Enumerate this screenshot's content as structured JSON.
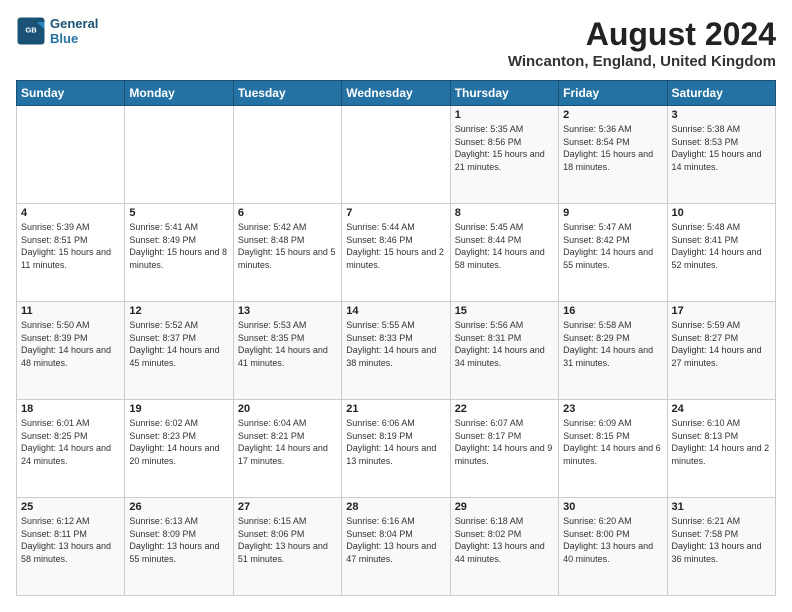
{
  "logo": {
    "line1": "General",
    "line2": "Blue"
  },
  "header": {
    "title": "August 2024",
    "subtitle": "Wincanton, England, United Kingdom"
  },
  "weekdays": [
    "Sunday",
    "Monday",
    "Tuesday",
    "Wednesday",
    "Thursday",
    "Friday",
    "Saturday"
  ],
  "weeks": [
    [
      {
        "day": "",
        "text": ""
      },
      {
        "day": "",
        "text": ""
      },
      {
        "day": "",
        "text": ""
      },
      {
        "day": "",
        "text": ""
      },
      {
        "day": "1",
        "text": "Sunrise: 5:35 AM\nSunset: 8:56 PM\nDaylight: 15 hours and 21 minutes."
      },
      {
        "day": "2",
        "text": "Sunrise: 5:36 AM\nSunset: 8:54 PM\nDaylight: 15 hours and 18 minutes."
      },
      {
        "day": "3",
        "text": "Sunrise: 5:38 AM\nSunset: 8:53 PM\nDaylight: 15 hours and 14 minutes."
      }
    ],
    [
      {
        "day": "4",
        "text": "Sunrise: 5:39 AM\nSunset: 8:51 PM\nDaylight: 15 hours and 11 minutes."
      },
      {
        "day": "5",
        "text": "Sunrise: 5:41 AM\nSunset: 8:49 PM\nDaylight: 15 hours and 8 minutes."
      },
      {
        "day": "6",
        "text": "Sunrise: 5:42 AM\nSunset: 8:48 PM\nDaylight: 15 hours and 5 minutes."
      },
      {
        "day": "7",
        "text": "Sunrise: 5:44 AM\nSunset: 8:46 PM\nDaylight: 15 hours and 2 minutes."
      },
      {
        "day": "8",
        "text": "Sunrise: 5:45 AM\nSunset: 8:44 PM\nDaylight: 14 hours and 58 minutes."
      },
      {
        "day": "9",
        "text": "Sunrise: 5:47 AM\nSunset: 8:42 PM\nDaylight: 14 hours and 55 minutes."
      },
      {
        "day": "10",
        "text": "Sunrise: 5:48 AM\nSunset: 8:41 PM\nDaylight: 14 hours and 52 minutes."
      }
    ],
    [
      {
        "day": "11",
        "text": "Sunrise: 5:50 AM\nSunset: 8:39 PM\nDaylight: 14 hours and 48 minutes."
      },
      {
        "day": "12",
        "text": "Sunrise: 5:52 AM\nSunset: 8:37 PM\nDaylight: 14 hours and 45 minutes."
      },
      {
        "day": "13",
        "text": "Sunrise: 5:53 AM\nSunset: 8:35 PM\nDaylight: 14 hours and 41 minutes."
      },
      {
        "day": "14",
        "text": "Sunrise: 5:55 AM\nSunset: 8:33 PM\nDaylight: 14 hours and 38 minutes."
      },
      {
        "day": "15",
        "text": "Sunrise: 5:56 AM\nSunset: 8:31 PM\nDaylight: 14 hours and 34 minutes."
      },
      {
        "day": "16",
        "text": "Sunrise: 5:58 AM\nSunset: 8:29 PM\nDaylight: 14 hours and 31 minutes."
      },
      {
        "day": "17",
        "text": "Sunrise: 5:59 AM\nSunset: 8:27 PM\nDaylight: 14 hours and 27 minutes."
      }
    ],
    [
      {
        "day": "18",
        "text": "Sunrise: 6:01 AM\nSunset: 8:25 PM\nDaylight: 14 hours and 24 minutes."
      },
      {
        "day": "19",
        "text": "Sunrise: 6:02 AM\nSunset: 8:23 PM\nDaylight: 14 hours and 20 minutes."
      },
      {
        "day": "20",
        "text": "Sunrise: 6:04 AM\nSunset: 8:21 PM\nDaylight: 14 hours and 17 minutes."
      },
      {
        "day": "21",
        "text": "Sunrise: 6:06 AM\nSunset: 8:19 PM\nDaylight: 14 hours and 13 minutes."
      },
      {
        "day": "22",
        "text": "Sunrise: 6:07 AM\nSunset: 8:17 PM\nDaylight: 14 hours and 9 minutes."
      },
      {
        "day": "23",
        "text": "Sunrise: 6:09 AM\nSunset: 8:15 PM\nDaylight: 14 hours and 6 minutes."
      },
      {
        "day": "24",
        "text": "Sunrise: 6:10 AM\nSunset: 8:13 PM\nDaylight: 14 hours and 2 minutes."
      }
    ],
    [
      {
        "day": "25",
        "text": "Sunrise: 6:12 AM\nSunset: 8:11 PM\nDaylight: 13 hours and 58 minutes."
      },
      {
        "day": "26",
        "text": "Sunrise: 6:13 AM\nSunset: 8:09 PM\nDaylight: 13 hours and 55 minutes."
      },
      {
        "day": "27",
        "text": "Sunrise: 6:15 AM\nSunset: 8:06 PM\nDaylight: 13 hours and 51 minutes."
      },
      {
        "day": "28",
        "text": "Sunrise: 6:16 AM\nSunset: 8:04 PM\nDaylight: 13 hours and 47 minutes."
      },
      {
        "day": "29",
        "text": "Sunrise: 6:18 AM\nSunset: 8:02 PM\nDaylight: 13 hours and 44 minutes."
      },
      {
        "day": "30",
        "text": "Sunrise: 6:20 AM\nSunset: 8:00 PM\nDaylight: 13 hours and 40 minutes."
      },
      {
        "day": "31",
        "text": "Sunrise: 6:21 AM\nSunset: 7:58 PM\nDaylight: 13 hours and 36 minutes."
      }
    ]
  ]
}
